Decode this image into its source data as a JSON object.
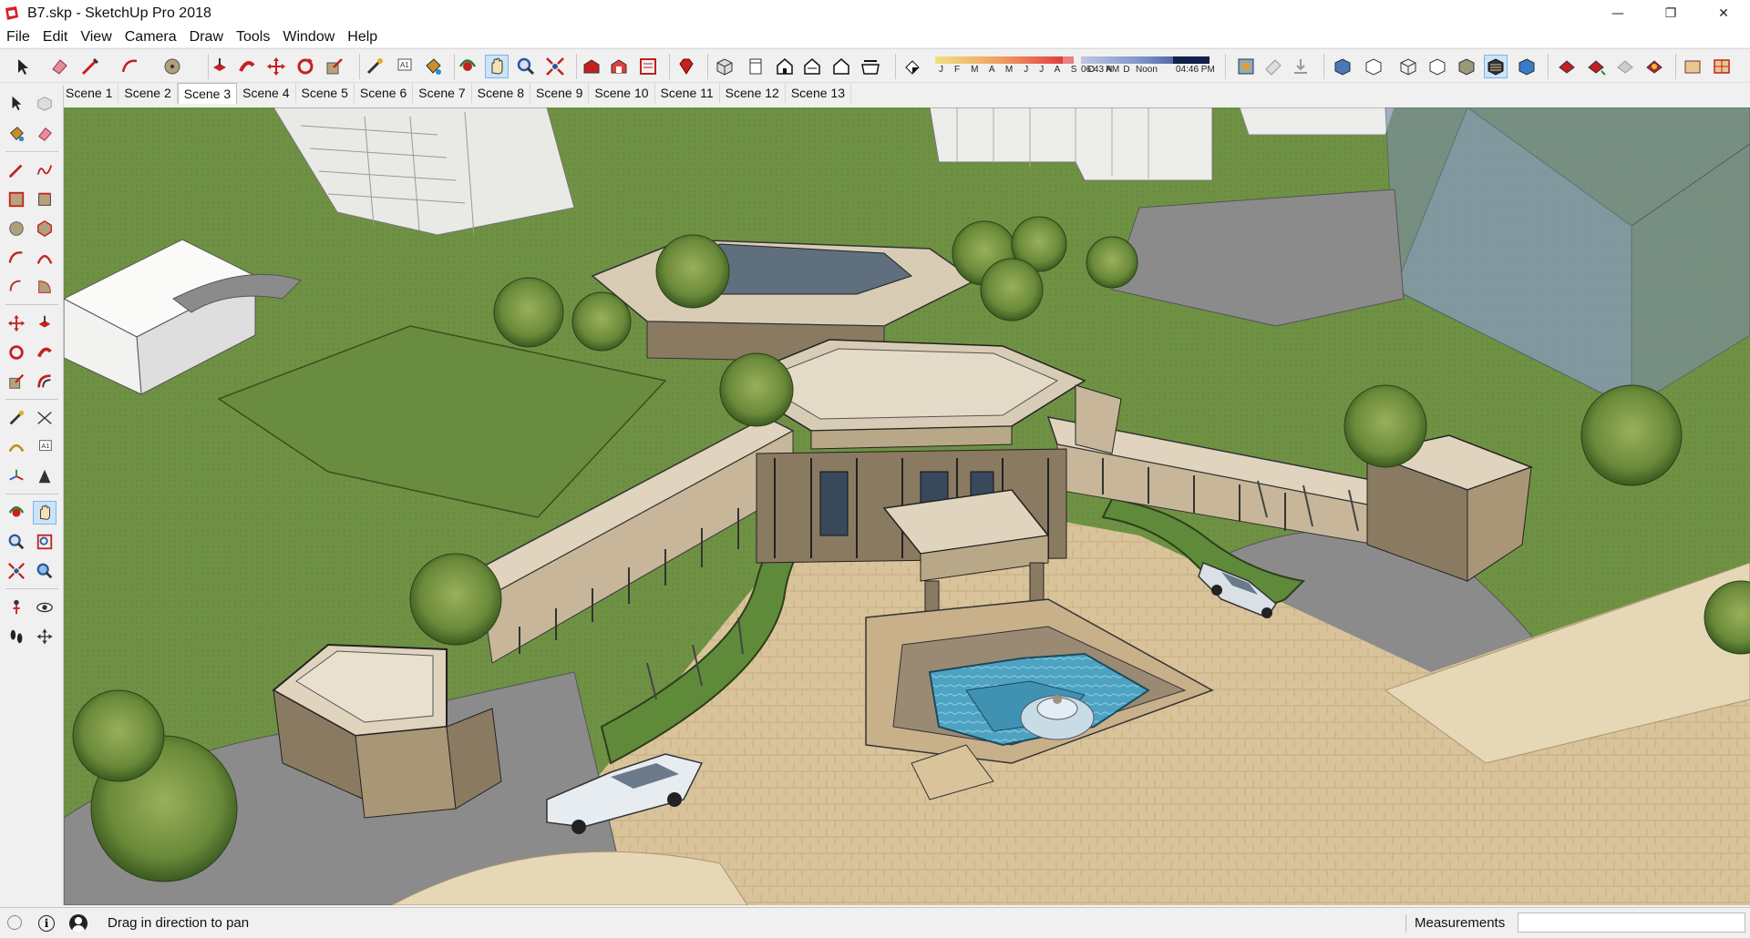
{
  "window": {
    "title": "B7.skp - SketchUp Pro 2018"
  },
  "menu": [
    "File",
    "Edit",
    "View",
    "Camera",
    "Draw",
    "Tools",
    "Window",
    "Help"
  ],
  "shadows": {
    "months": "J F M A M J J A S O N D",
    "time_start": "06:43 AM",
    "time_mid": "Noon",
    "time_end": "04:46 PM"
  },
  "scenes": [
    "Scene 1",
    "Scene 2",
    "Scene 3",
    "Scene 4",
    "Scene 5",
    "Scene 6",
    "Scene 7",
    "Scene 8",
    "Scene 9",
    "Scene 10",
    "Scene 11",
    "Scene 12",
    "Scene 13"
  ],
  "active_scene": "Scene 3",
  "status": {
    "hint": "Drag in direction to pan",
    "measurements_label": "Measurements",
    "measurements_value": ""
  },
  "toolbar_icons": [
    "select-icon",
    "eraser-icon",
    "line-icon",
    "arc-icon",
    "circle-icon",
    "push-pull-icon",
    "follow-me-icon",
    "move-icon",
    "rotate-icon",
    "scale-icon",
    "tape-measure-icon",
    "text-icon",
    "paint-bucket-icon",
    "orbit-icon",
    "pan-icon",
    "zoom-icon",
    "zoom-extents-icon",
    "warehouse-icon",
    "extension-warehouse-icon",
    "layout-icon",
    "ruby-icon",
    "iso-view-icon",
    "top-view-icon",
    "front-view-icon",
    "right-view-icon",
    "back-view-icon",
    "left-view-icon",
    "shadow-toggle-icon",
    "section-plane-icon",
    "xray-icon",
    "wireframe-icon",
    "hidden-line-icon",
    "shaded-icon",
    "shaded-textures-icon",
    "monochrome-icon",
    "sandbox-icon"
  ],
  "colors": {
    "accent_active": "#cce4f7",
    "grass": "#6e8f43",
    "paving": "#d9c39a",
    "road": "#8b8b8b"
  }
}
